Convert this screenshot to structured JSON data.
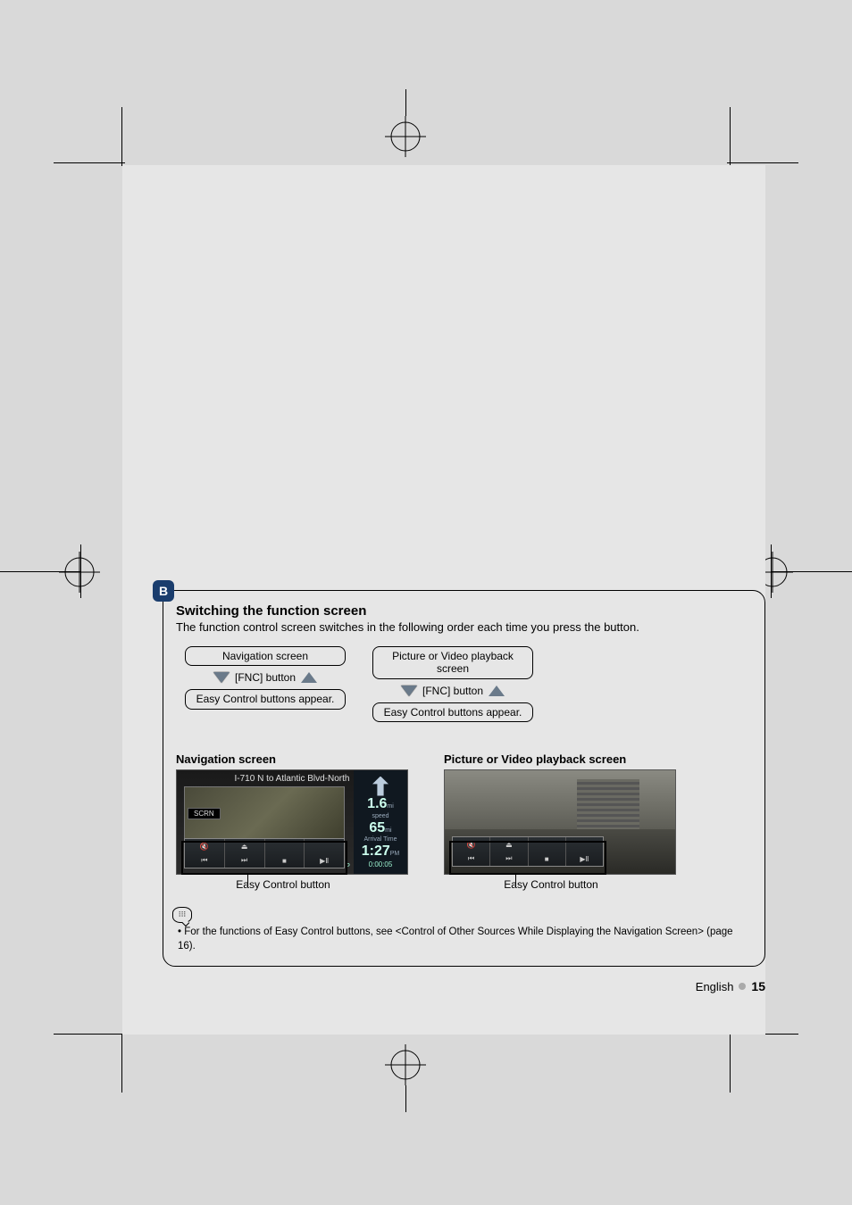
{
  "section": {
    "badge": "B",
    "title": "Switching the function screen",
    "subtitle": "The function control screen switches in the following order each time you press the button."
  },
  "flow": {
    "left": {
      "top": "Navigation screen",
      "mid": "[FNC] button",
      "bot": "Easy Control buttons appear."
    },
    "right": {
      "top": "Picture or Video playback screen",
      "mid": "[FNC] button",
      "bot": "Easy Control buttons appear."
    }
  },
  "examples": {
    "left": {
      "title": "Navigation screen",
      "caption": "Easy Control button",
      "nav_dest": "I-710 N to Atlantic Blvd-North",
      "scrn": "SCRN",
      "dist": "1.6",
      "dist_unit": "mi",
      "speed_lbl": "speed",
      "speed": "65",
      "speed_unit": "mi",
      "arrival_lbl": "Arrival Time",
      "arrival": "1:27",
      "arrival_unit": "PM",
      "p": "P",
      "time": "0:00:05"
    },
    "right": {
      "title": "Picture or Video playback screen",
      "caption": "Easy Control button"
    }
  },
  "note": "For the functions of Easy Control buttons, see <Control of Other Sources While Displaying the Navigation Screen> (page 16).",
  "footer": {
    "lang": "English",
    "page": "15"
  }
}
